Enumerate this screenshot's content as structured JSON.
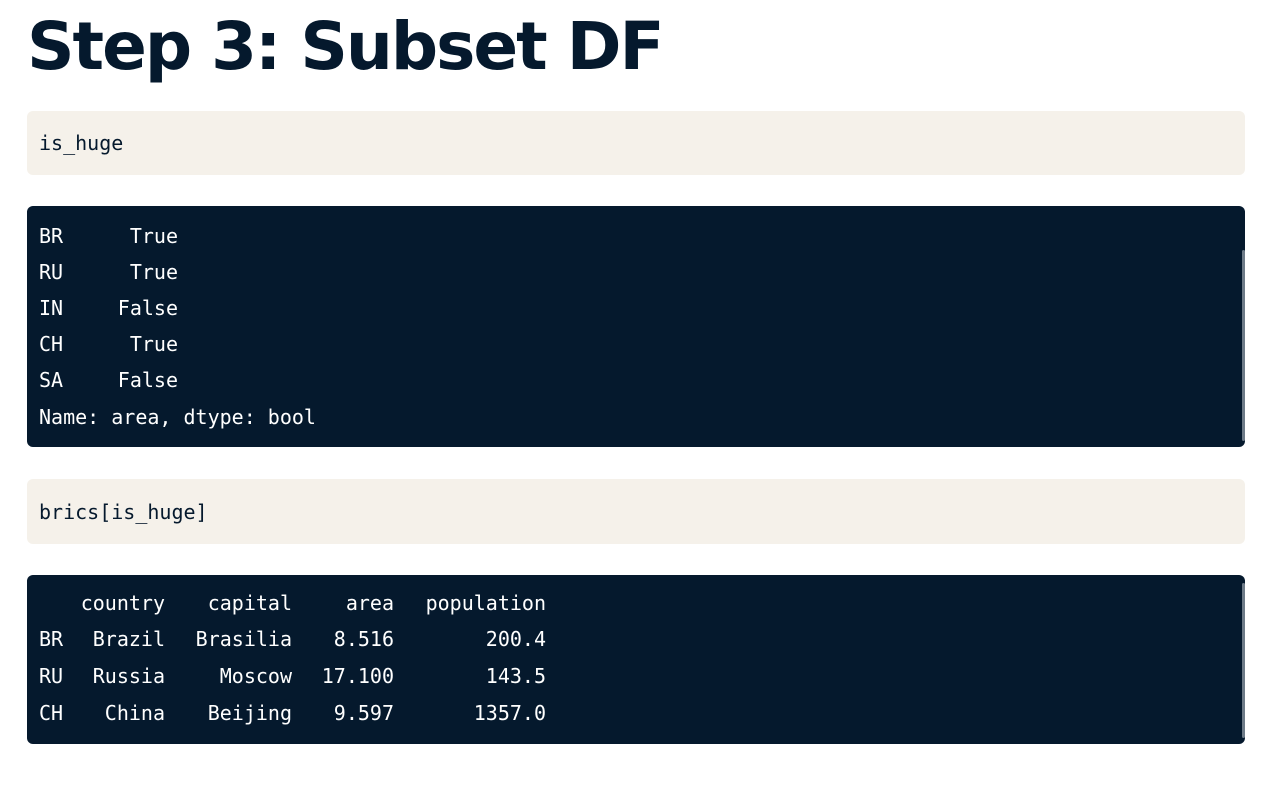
{
  "heading": "Step 3: Subset DF",
  "cells": [
    {
      "input": "is_huge",
      "output": {
        "type": "series",
        "rows": [
          {
            "index": "BR",
            "value": "True"
          },
          {
            "index": "RU",
            "value": "True"
          },
          {
            "index": "IN",
            "value": "False"
          },
          {
            "index": "CH",
            "value": "True"
          },
          {
            "index": "SA",
            "value": "False"
          }
        ],
        "footer": "Name: area, dtype: bool"
      }
    },
    {
      "input": "brics[is_huge]",
      "output": {
        "type": "dataframe",
        "columns": [
          "country",
          "capital",
          "area",
          "population"
        ],
        "rows": [
          {
            "index": "BR",
            "country": "Brazil",
            "capital": "Brasilia",
            "area": "8.516",
            "population": "200.4"
          },
          {
            "index": "RU",
            "country": "Russia",
            "capital": "Moscow",
            "area": "17.100",
            "population": "143.5"
          },
          {
            "index": "CH",
            "country": "China",
            "capital": "Beijing",
            "area": "9.597",
            "population": "1357.0"
          }
        ]
      }
    }
  ],
  "colors": {
    "heading": "#05192d",
    "input_bg": "#f5f1ea",
    "output_bg": "#05192d",
    "output_text": "#ffffff"
  }
}
